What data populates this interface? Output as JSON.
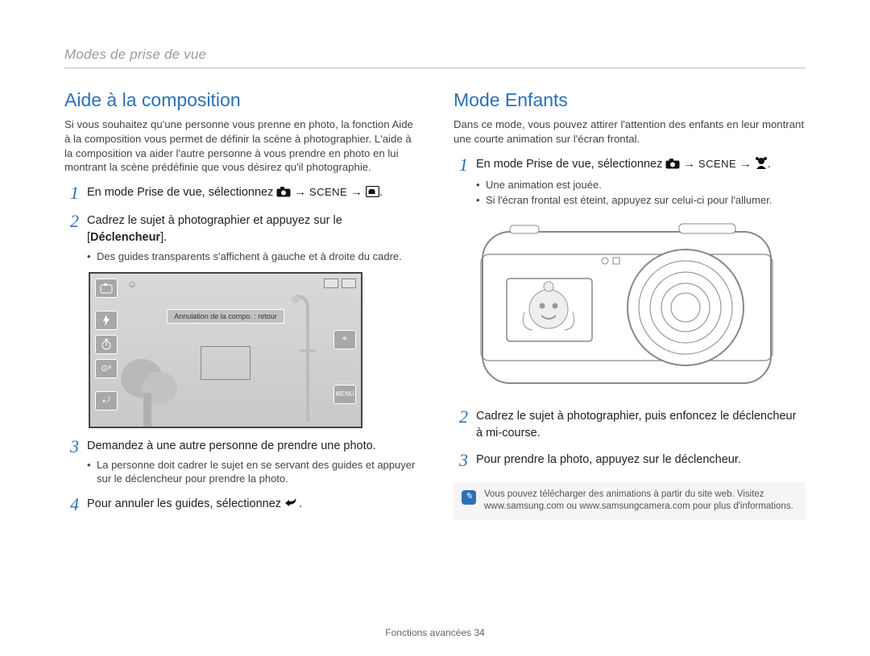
{
  "breadcrumb": "Modes de prise de vue",
  "left": {
    "title": "Aide à la composition",
    "intro": "Si vous souhaitez qu'une personne vous prenne en photo, la fonction Aide à la composition vous permet de définir la scène à photographier. L'aide à la composition va aider l'autre personne à vous prendre en photo en lui montrant la scène prédéfinie que vous désirez qu'il photographie.",
    "step1_pre": "En mode Prise de vue, sélectionnez ",
    "scene_label": "SCENE",
    "step2_text": "Cadrez le sujet à photographier et appuyez sur le [",
    "step2_bold": "Déclencheur",
    "step2_after": "].",
    "step2_bullet": "Des guides transparents s'affichent à gauche et à droite du cadre.",
    "banner": "Annulation de la compo. : retour",
    "step3_text": "Demandez à une autre personne de prendre une photo.",
    "step3_bullet": "La personne doit cadrer le sujet en se servant des guides et appuyer sur le déclencheur pour prendre la photo.",
    "step4_text": "Pour annuler les guides, sélectionnez ",
    "icon_left1": "⤾",
    "icon_menu": "MENU",
    "icon_target": "⌖"
  },
  "right": {
    "title": "Mode Enfants",
    "intro": "Dans ce mode, vous pouvez attirer l'attention des enfants en leur montrant une courte animation sur l'écran frontal.",
    "step1_pre": "En mode Prise de vue, sélectionnez ",
    "scene_label": "SCENE",
    "bullet1": "Une animation est jouée.",
    "bullet2": "Si l'écran frontal est éteint, appuyez sur celui-ci pour l'allumer.",
    "step2": "Cadrez le sujet à photographier, puis enfoncez le déclencheur à mi-course.",
    "step3": "Pour prendre la photo, appuyez sur le déclencheur.",
    "note": "Vous pouvez télécharger des animations à partir du site web. Visitez www.samsung.com ou www.samsungcamera.com pour plus d'informations."
  },
  "footer_label": "Fonctions avancées ",
  "page_number": "34"
}
